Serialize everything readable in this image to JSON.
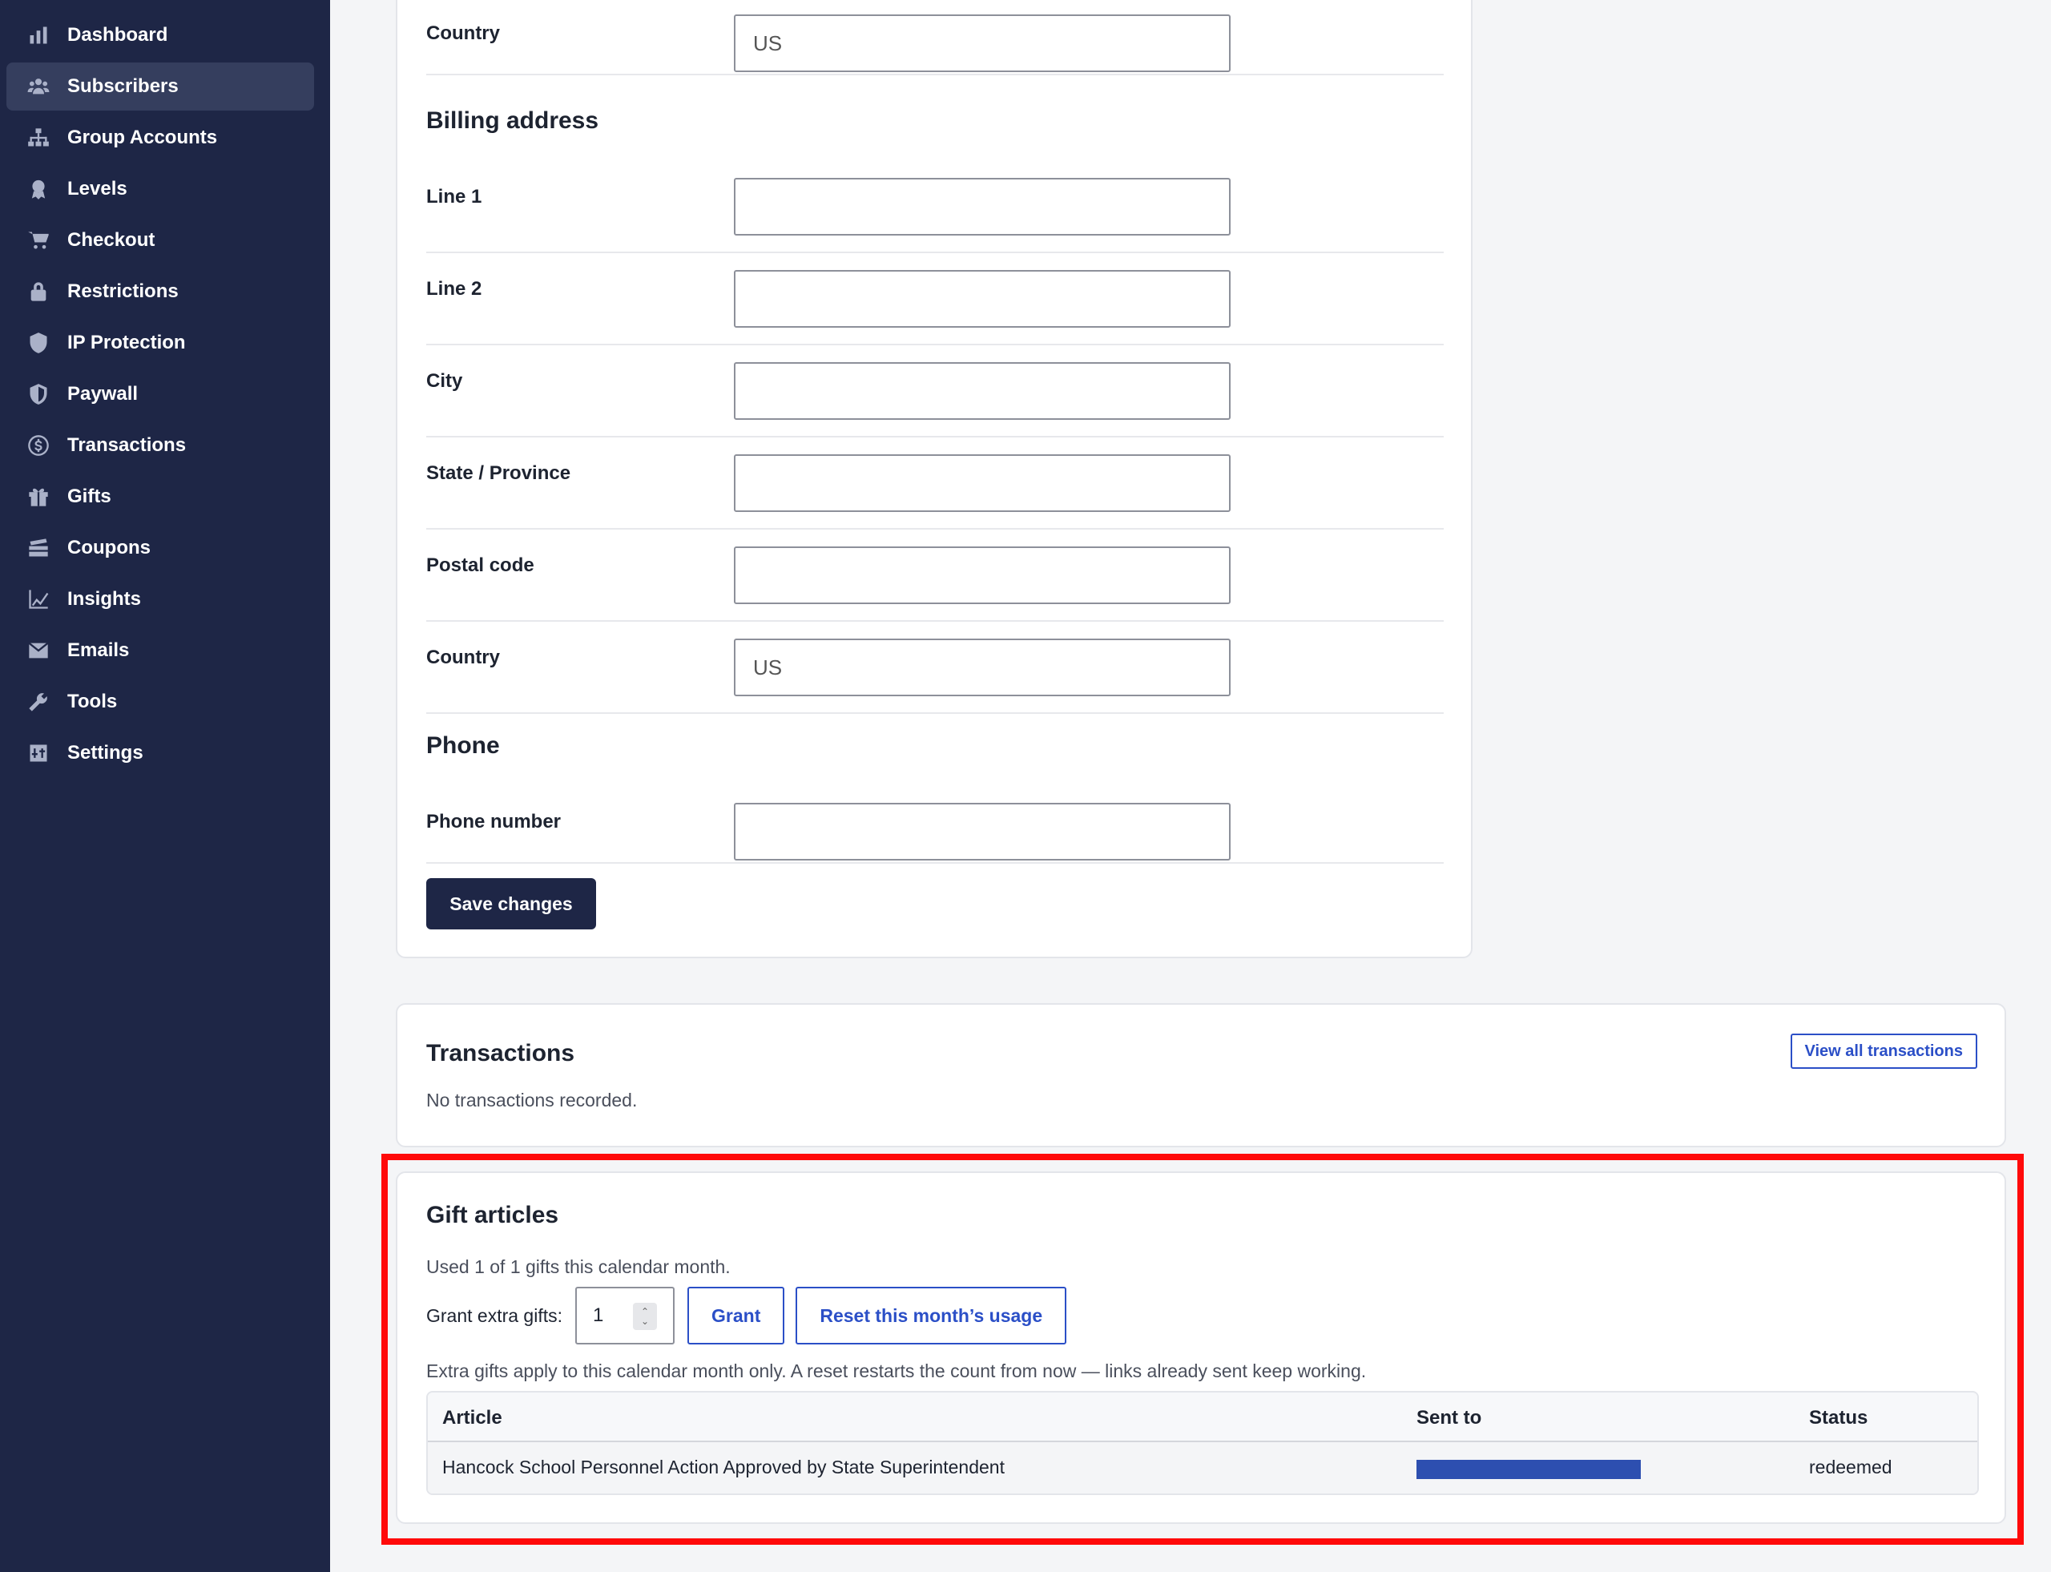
{
  "sidebar": {
    "items": [
      {
        "label": "Dashboard",
        "icon": "bar-chart-icon"
      },
      {
        "label": "Subscribers",
        "icon": "users-icon",
        "active": true
      },
      {
        "label": "Group Accounts",
        "icon": "sitemap-icon"
      },
      {
        "label": "Levels",
        "icon": "award-icon"
      },
      {
        "label": "Checkout",
        "icon": "cart-icon"
      },
      {
        "label": "Restrictions",
        "icon": "lock-icon"
      },
      {
        "label": "IP Protection",
        "icon": "shield-icon"
      },
      {
        "label": "Paywall",
        "icon": "shield-half-icon"
      },
      {
        "label": "Transactions",
        "icon": "dollar-circle-icon"
      },
      {
        "label": "Gifts",
        "icon": "gift-icon"
      },
      {
        "label": "Coupons",
        "icon": "coupon-stack-icon"
      },
      {
        "label": "Insights",
        "icon": "line-chart-icon"
      },
      {
        "label": "Emails",
        "icon": "envelope-icon"
      },
      {
        "label": "Tools",
        "icon": "wrench-icon"
      },
      {
        "label": "Settings",
        "icon": "settings-box-icon"
      }
    ]
  },
  "profile": {
    "country_top": {
      "label": "Country",
      "value": "US"
    },
    "billing": {
      "heading": "Billing address",
      "line1": {
        "label": "Line 1",
        "value": ""
      },
      "line2": {
        "label": "Line 2",
        "value": ""
      },
      "city": {
        "label": "City",
        "value": ""
      },
      "state": {
        "label": "State / Province",
        "value": ""
      },
      "postal": {
        "label": "Postal code",
        "value": ""
      },
      "country": {
        "label": "Country",
        "value": "US"
      }
    },
    "phone": {
      "heading": "Phone",
      "number": {
        "label": "Phone number",
        "value": ""
      }
    },
    "save_label": "Save changes"
  },
  "transactions": {
    "title": "Transactions",
    "view_all_label": "View all transactions",
    "empty_text": "No transactions recorded."
  },
  "gifts": {
    "title": "Gift articles",
    "usage_text": "Used 1 of 1 gifts this calendar month.",
    "grant_label": "Grant extra gifts:",
    "grant_value": "1",
    "grant_button": "Grant",
    "reset_button": "Reset this month’s usage",
    "note": "Extra gifts apply to this calendar month only. A reset restarts the count from now — links already sent keep working.",
    "columns": [
      "Article",
      "Sent to",
      "Status"
    ],
    "rows": [
      {
        "article": "Hancock School Personnel Action Approved by State Superintendent",
        "sent_to": "",
        "status": "redeemed"
      }
    ]
  },
  "colors": {
    "sidebar_bg": "#1e2646",
    "accent": "#2b4fc7",
    "highlight": "#ff0a0a"
  }
}
